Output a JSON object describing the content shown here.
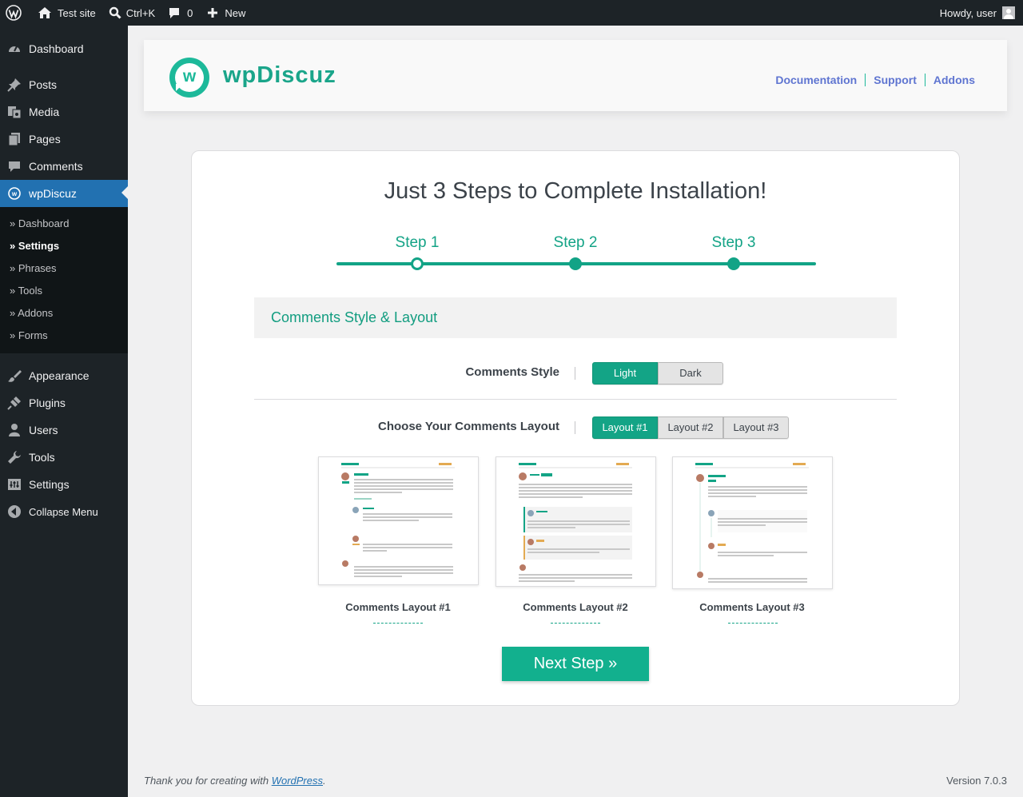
{
  "admin_bar": {
    "site_name": "Test site",
    "search_shortcut": "Ctrl+K",
    "comments_count": "0",
    "new_label": "New",
    "greeting": "Howdy, user"
  },
  "sidebar": {
    "items": [
      {
        "label": "Dashboard",
        "icon": "dashboard-icon"
      },
      {
        "label": "Posts",
        "icon": "pin-icon"
      },
      {
        "label": "Media",
        "icon": "media-icon"
      },
      {
        "label": "Pages",
        "icon": "pages-icon"
      },
      {
        "label": "Comments",
        "icon": "comment-icon"
      },
      {
        "label": "wpDiscuz",
        "icon": "wpdiscuz-icon"
      }
    ],
    "submenu": [
      "» Dashboard",
      "» Settings",
      "» Phrases",
      "» Tools",
      "» Addons",
      "» Forms"
    ],
    "items_bottom": [
      {
        "label": "Appearance",
        "icon": "brush-icon"
      },
      {
        "label": "Plugins",
        "icon": "plug-icon"
      },
      {
        "label": "Users",
        "icon": "user-icon"
      },
      {
        "label": "Tools",
        "icon": "wrench-icon"
      },
      {
        "label": "Settings",
        "icon": "settings-icon"
      }
    ],
    "collapse": "Collapse Menu"
  },
  "header": {
    "logo_letter": "w",
    "brand": "wpDiscuz",
    "links": [
      "Documentation",
      "Support",
      "Addons"
    ]
  },
  "wizard": {
    "title": "Just 3 Steps to Complete Installation!",
    "steps": [
      "Step 1",
      "Step 2",
      "Step 3"
    ],
    "current_step": 1,
    "section_title": "Comments Style & Layout",
    "style_label": "Comments Style",
    "style_options": [
      "Light",
      "Dark"
    ],
    "style_selected": "Light",
    "layout_label": "Choose Your Comments Layout",
    "layout_options": [
      "Layout #1",
      "Layout #2",
      "Layout #3"
    ],
    "layout_selected": "Layout #1",
    "layout_captions": [
      "Comments Layout #1",
      "Comments Layout #2",
      "Comments Layout #3"
    ],
    "dash_text": "------------",
    "next_button": "Next Step »"
  },
  "footer": {
    "thanks_prefix": "Thank you for creating with ",
    "thanks_link": "WordPress",
    "thanks_suffix": ".",
    "version": "Version 7.0.3"
  },
  "colors": {
    "accent": "#13a486",
    "admin_dark": "#1d2327",
    "current_menu": "#2271b1",
    "link_blue": "#5f75d1"
  }
}
